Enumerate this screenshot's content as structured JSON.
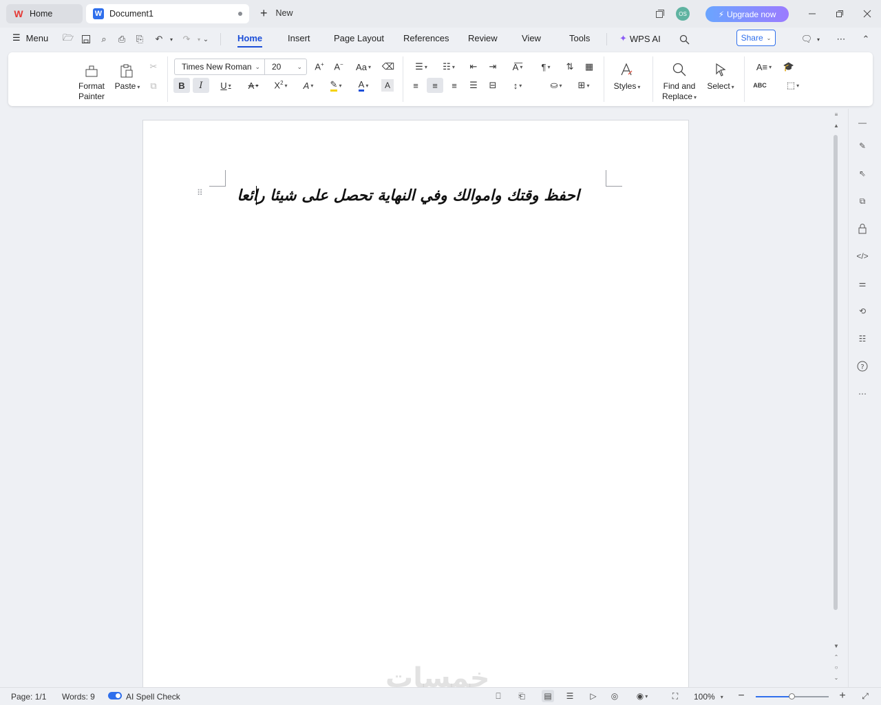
{
  "tabs": {
    "home_label": "Home",
    "doc_label": "Document1",
    "new_label": "New"
  },
  "titlebar": {
    "avatar_initials": "OS",
    "upgrade_label": "Upgrade now"
  },
  "menubar": {
    "menu_label": "Menu",
    "items": [
      "Home",
      "Insert",
      "Page Layout",
      "References",
      "Review",
      "View",
      "Tools"
    ],
    "active": "Home",
    "wps_ai_label": "WPS AI",
    "share_label": "Share"
  },
  "ribbon": {
    "format_painter_line1": "Format",
    "format_painter_line2": "Painter",
    "paste_label": "Paste",
    "font_name": "Times New Roman",
    "font_size": "20",
    "styles_label": "Styles",
    "find_replace_line1": "Find and",
    "find_replace_line2": "Replace",
    "select_label": "Select",
    "spell_label": "ABC"
  },
  "document": {
    "text": "احفظ وقتك واموالك وفي النهاية تحصل على شيئا رائعا",
    "watermark": "خمسات"
  },
  "statusbar": {
    "page": "Page: 1/1",
    "words": "Words: 9",
    "spell_check": "AI Spell Check",
    "zoom": "100%",
    "zoom_level": 0.5
  },
  "colors": {
    "accent": "#1b4ed8",
    "highlight": "#f5d200",
    "font_color": "#1b4ed8"
  }
}
